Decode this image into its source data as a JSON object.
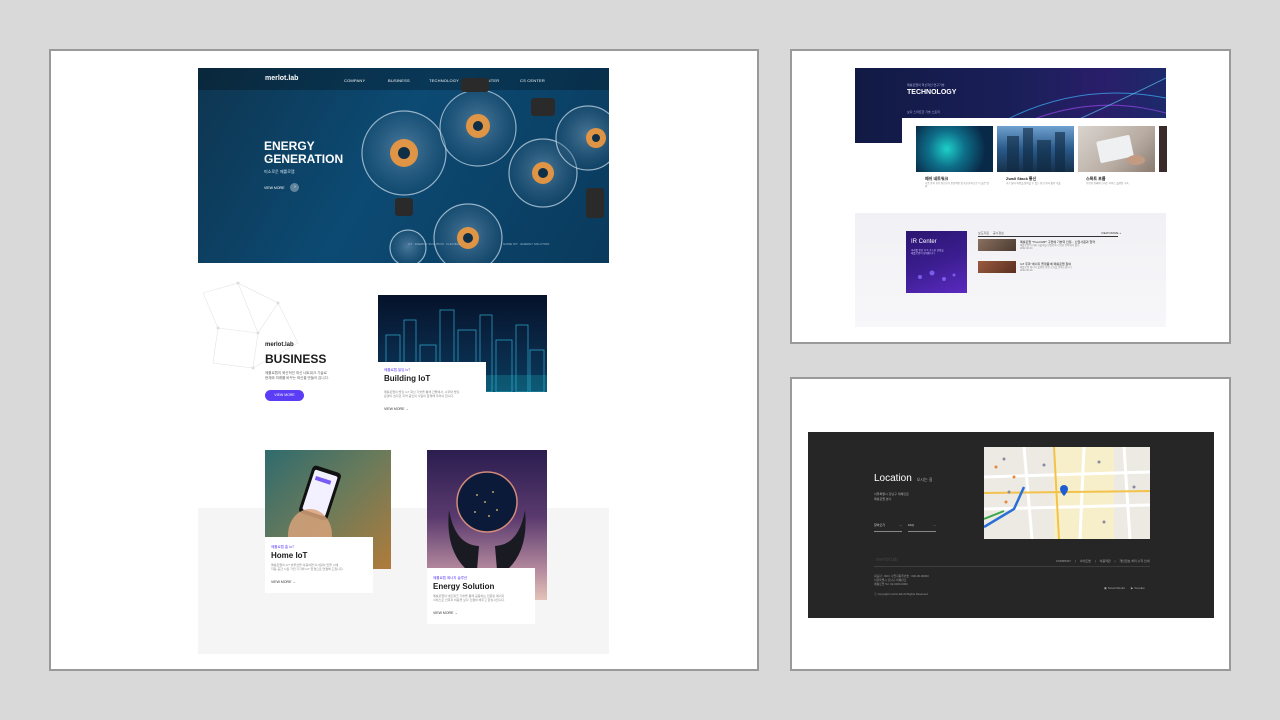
{
  "main_site": {
    "header": {
      "logo": "merlot.lab",
      "nav": [
        "COMPANY",
        "BUSINESS",
        "TECHNOLOGY",
        "IR CENTER",
        "CS CENTER"
      ]
    },
    "hero": {
      "title_line1": "ENERGY",
      "title_line2": "GENERATION",
      "subtitle": "미소로운 메를로랩",
      "cta": "VIEW MORE",
      "footnote_left": "IoT · ENERGY SOLUTION · FLEXIBLE",
      "footnote_right": "HOME IOT · ENERGY SOLUTION"
    },
    "business": {
      "logo": "merlot.lab",
      "title": "BUSINESS",
      "desc_line1": "메를로랩의 혁신적인 최신 네트워크 기술로",
      "desc_line2": "현재와 미래를 바꾸는 혁신을 만들어 갑니다.",
      "button": "VIEW MORE"
    },
    "cards": [
      {
        "tag": "메를로랩 빌딩 IoT",
        "title": "Building IoT",
        "desc_line1": "메를로랩의 빌딩 IoT 최신 기술을 통해 건물에서, 시무와 빌딩",
        "desc_line2": "운영이 쉽다던 지역 중인의 사람이 함께해 주어야 합니다.",
        "link": "VIEW MORE"
      },
      {
        "tag": "메를로랩 홈 IoT",
        "title": "Home IoT",
        "desc_line1": "메를로랩의 IoT 솔루션을 이용하면 이사람이 있을 시에",
        "desc_line2": "자동 공간 시된 가전 기기와 IoT 환경으로 연결해 드립니다.",
        "link": "VIEW MORE"
      },
      {
        "tag": "메를로랩 에너지 솔루션",
        "title": "Energy Solution",
        "desc_line1": "메를로랩의 네트워크 기술을 통해 공용하는 전문된 에너지",
        "desc_line2": "서비스로 인력과 비용을 보다 간결히 해주고 향상시킵니다.",
        "link": "VIEW MORE"
      }
    ]
  },
  "technology": {
    "kicker": "메를로랩의 혁신적인 연구기술",
    "title": "TECHNOLOGY",
    "tagline": "보다 스마트한 기술 스토리",
    "items": [
      {
        "title": "메쉬 네트워크",
        "desc": "기존 방식 무선 통신보다 안정적인 망구성 방식으로 더 넓은 범위"
      },
      {
        "title": "Zwall Stack 통신",
        "desc": "서로 달리 비용을 절약할 수 있는 통신 방식 활용 기술"
      },
      {
        "title": "스목트 포룸",
        "desc": "다양한 형태의 스마트 서비스 플랫폼 구축"
      }
    ]
  },
  "ir": {
    "title": "IR Center",
    "desc_line1": "미래를 향한 지속 가능한 성장을",
    "desc_line2": "메를로랩이 함께합니다",
    "tabs": [
      "보도자료",
      "공시정보"
    ],
    "more": "VIEW MORE +",
    "news": [
      {
        "title": "메를로랩 \"Trust IMP\" 구현에 기술력 인정... 신입사원과 협약",
        "desc": "메를로랩이 미래 기술력을 인정받아 다양한 분야에서 활동",
        "date": "2022.00.00"
      },
      {
        "title": "IoT 주파 '에너지 플랫폼'에 메를로랩 참여",
        "desc": "메를로랩 에너지 플랫폼 관련 소식을 전해드립니다",
        "date": "2022.00.00"
      }
    ]
  },
  "footer": {
    "location_title": "Location",
    "location_sub": "오시는 길",
    "address_line1": "서울특별시 강남구 테헤란로",
    "address_line2": "메를로랩 본사",
    "btn_directions": "찾아오기",
    "btn_faq": "FAQ",
    "logo": "merlot.lab",
    "links": [
      "COMPANY",
      "사이트맵",
      "이용약관",
      "개인정보 처리 수칙 안내"
    ],
    "info_line1": "대표자 : 000 | 사업자등록번호 : 000-00-00000",
    "info_line2": "서울특별시 강남구 테헤란로",
    "info_line3": "메를로랩 Tel. 02-0000-0000",
    "copyright": "ⓒ Copyright merlot.lab All Rights Reserved.",
    "social1": "Smart Merlot",
    "social2": "Youtube"
  },
  "colors": {
    "accent": "#5b3df5",
    "hero_bg": "#0c4a73",
    "footer_bg": "#262626",
    "tech_bg": "#0f1438"
  }
}
